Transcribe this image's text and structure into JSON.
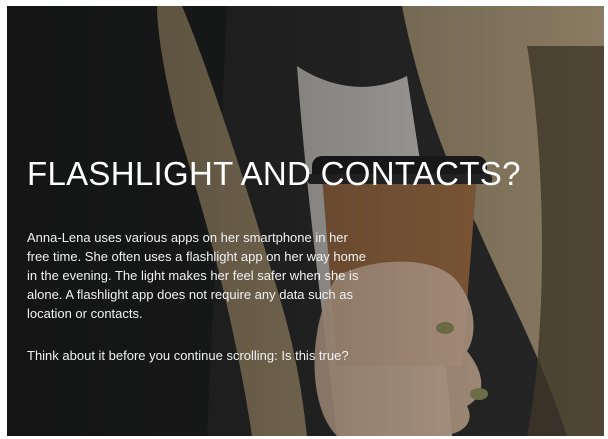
{
  "slide": {
    "title": "FLASHLIGHT AND CONTACTS?",
    "paragraph_1": "Anna-Lena uses various apps on her smartphone in her free time. She often uses a flashlight app on her way home in the evening. The light makes her feel safer when she is alone. A flashlight app does not require any data such as location or contacts.",
    "paragraph_2": "Think about it before you continue scrolling: Is this true?"
  },
  "colors": {
    "text": "#ffffff",
    "coffee_cup": "#9a6a42",
    "cup_lid": "#1c1c1c",
    "hair": "#c8b28a",
    "nail_polish": "#8a8a5a"
  }
}
